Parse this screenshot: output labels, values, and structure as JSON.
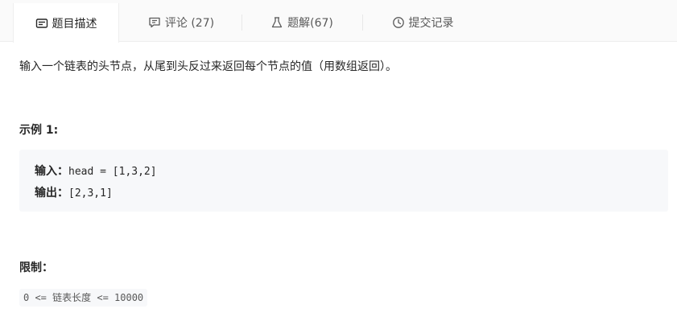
{
  "tabs": [
    {
      "label": "题目描述",
      "icon": "description-icon",
      "active": true
    },
    {
      "label": "评论 (27)",
      "icon": "comment-icon",
      "active": false
    },
    {
      "label": "题解(67)",
      "icon": "flask-icon",
      "active": false
    },
    {
      "label": "提交记录",
      "icon": "clock-icon",
      "active": false
    }
  ],
  "problem": {
    "description": "输入一个链表的头节点，从尾到头反过来返回每个节点的值（用数组返回）。",
    "example_title": "示例 1:",
    "example": {
      "input_label": "输入：",
      "input_value": "head = [1,3,2]",
      "output_label": "输出：",
      "output_value": "[2,3,1]"
    },
    "limits_title": "限制：",
    "constraint": "0 <= 链表长度 <= 10000"
  },
  "colors": {
    "tab_bg": "#fafafa",
    "code_bg": "#f7f8fa",
    "text": "#262626",
    "muted": "#595959"
  }
}
